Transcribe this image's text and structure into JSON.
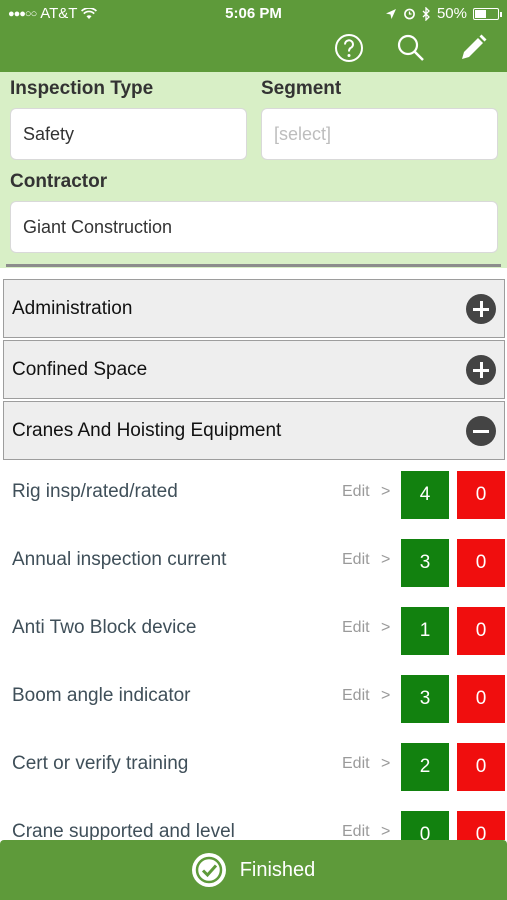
{
  "status_bar": {
    "carrier": "AT&T",
    "time": "5:06 PM",
    "battery": "50%",
    "battery_level": 0.5
  },
  "toolbar": {
    "icons": [
      "help-icon",
      "search-icon",
      "edit-pencil-icon"
    ]
  },
  "form": {
    "inspection_type": {
      "label": "Inspection Type",
      "value": "Safety"
    },
    "segment": {
      "label": "Segment",
      "placeholder": "[select]"
    },
    "contractor": {
      "label": "Contractor",
      "value": "Giant Construction"
    }
  },
  "sections": [
    {
      "label": "Administration",
      "state": "collapsed"
    },
    {
      "label": "Confined Space",
      "state": "collapsed"
    },
    {
      "label": "Cranes And Hoisting Equipment",
      "state": "expanded"
    }
  ],
  "items": [
    {
      "name": "Rig insp/rated/rated",
      "edit": "Edit",
      "chevron": ">",
      "good": "4",
      "bad": "0"
    },
    {
      "name": "Annual inspection current",
      "edit": "Edit",
      "chevron": ">",
      "good": "3",
      "bad": "0"
    },
    {
      "name": "Anti Two Block device",
      "edit": "Edit",
      "chevron": ">",
      "good": "1",
      "bad": "0"
    },
    {
      "name": "Boom angle indicator",
      "edit": "Edit",
      "chevron": ">",
      "good": "3",
      "bad": "0"
    },
    {
      "name": "Cert or verify training",
      "edit": "Edit",
      "chevron": ">",
      "good": "2",
      "bad": "0"
    },
    {
      "name": "Crane supported and level",
      "edit": "Edit",
      "chevron": ">",
      "good": "0",
      "bad": "0"
    }
  ],
  "footer": {
    "button_label": "Finished"
  },
  "colors": {
    "header": "#5e9a3a",
    "form_bg": "#d8efc6",
    "good": "#12810f",
    "bad": "#f00e0e"
  }
}
